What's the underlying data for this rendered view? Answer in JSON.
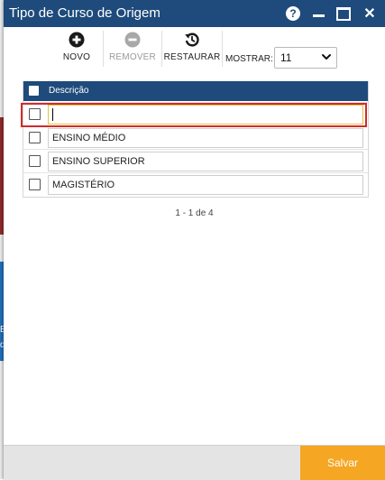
{
  "window": {
    "title": "Tipo de Curso de Origem",
    "help_glyph": "?",
    "close_glyph": "✕"
  },
  "toolbar": {
    "novo_label": "NOVO",
    "remover_label": "REMOVER",
    "restaurar_label": "RESTAURAR",
    "mostrar_label": "MOSTRAR:",
    "mostrar_value": "11"
  },
  "table": {
    "header": "Descrição",
    "rows": [
      {
        "value": "",
        "editing": true
      },
      {
        "value": "ENSINO MÉDIO"
      },
      {
        "value": "ENSINO SUPERIOR"
      },
      {
        "value": "MAGISTÉRIO"
      }
    ]
  },
  "pager": {
    "text": "1 - 1 de 4"
  },
  "footer": {
    "save_label": "Salvar"
  },
  "colors": {
    "titlebar": "#1e4b7b",
    "header": "#1e4b7b",
    "save": "#f5a623",
    "highlight": "#d22b2b"
  },
  "icons": {
    "novo": "plus-circle-icon",
    "remover": "minus-circle-icon",
    "restaurar": "restore-icon",
    "select": "chevron-down-icon"
  },
  "background": {
    "glyphs": [
      "E",
      "d"
    ]
  }
}
